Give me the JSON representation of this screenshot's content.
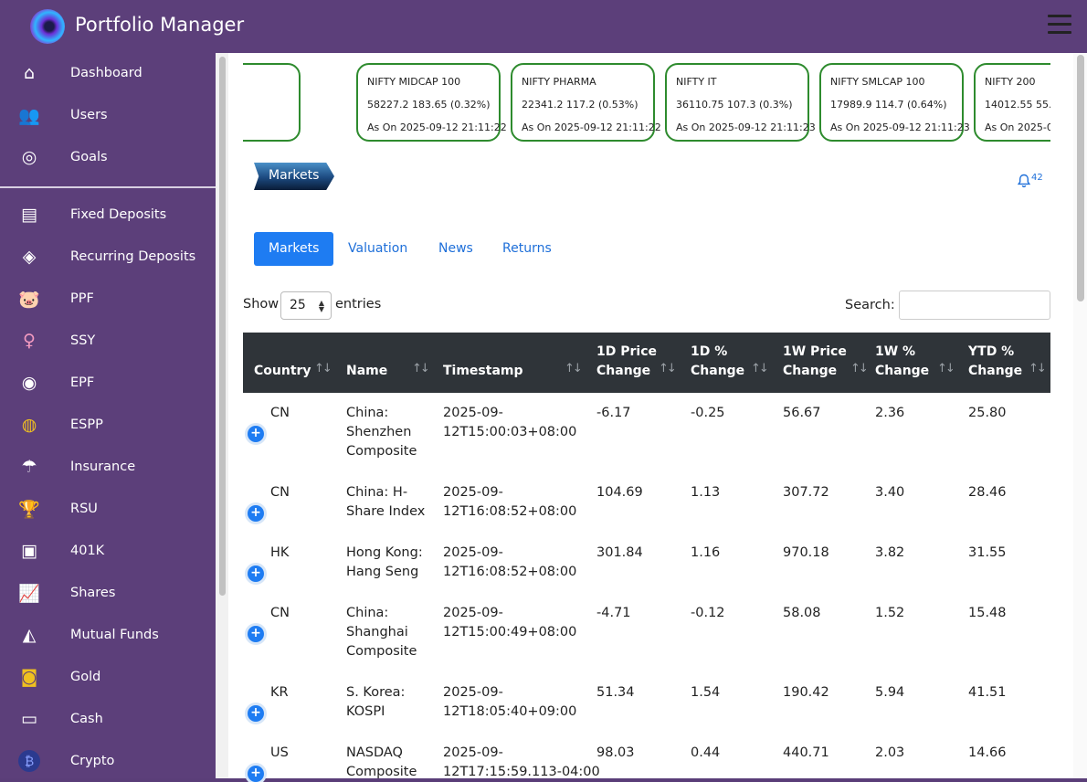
{
  "app": {
    "title": "Portfolio Manager"
  },
  "sidebar": {
    "items": [
      {
        "label": "Dashboard",
        "icon": "home-icon"
      },
      {
        "label": "Users",
        "icon": "users-icon"
      },
      {
        "label": "Goals",
        "icon": "target-icon"
      },
      {
        "label": "Fixed Deposits",
        "icon": "credit-card-icon"
      },
      {
        "label": "Recurring Deposits",
        "icon": "layers-icon"
      },
      {
        "label": "PPF",
        "icon": "piggy-bank-icon"
      },
      {
        "label": "SSY",
        "icon": "girl-icon"
      },
      {
        "label": "EPF",
        "icon": "epf-logo-icon"
      },
      {
        "label": "ESPP",
        "icon": "espp-icon"
      },
      {
        "label": "Insurance",
        "icon": "umbrella-icon"
      },
      {
        "label": "RSU",
        "icon": "trophy-icon"
      },
      {
        "label": "401K",
        "icon": "401k-icon"
      },
      {
        "label": "Shares",
        "icon": "chart-line-icon"
      },
      {
        "label": "Mutual Funds",
        "icon": "mutual-funds-icon"
      },
      {
        "label": "Gold",
        "icon": "gold-coins-icon"
      },
      {
        "label": "Cash",
        "icon": "cash-icon"
      },
      {
        "label": "Crypto",
        "icon": "bitcoin-icon"
      }
    ]
  },
  "ticker": [
    {
      "name": "",
      "value": "0.38%)",
      "date": "-12 21:11:22"
    },
    {
      "name": "NIFTY MIDCAP 100",
      "value": "58227.2  183.65 (0.32%)",
      "date": "As On 2025-09-12 21:11:22"
    },
    {
      "name": "NIFTY PHARMA",
      "value": "22341.2  117.2 (0.53%)",
      "date": "As On 2025-09-12 21:11:22"
    },
    {
      "name": "NIFTY IT",
      "value": "36110.75  107.3 (0.3%)",
      "date": "As On 2025-09-12 21:11:23"
    },
    {
      "name": "NIFTY SMLCAP 100",
      "value": "17989.9  114.7 (0.64%)",
      "date": "As On 2025-09-12 21:11:23"
    },
    {
      "name": "NIFTY 200",
      "value": "14012.55  55.5",
      "date": "As On 2025-0"
    }
  ],
  "page": {
    "ribbon": "Markets",
    "notifications": "42"
  },
  "tabs": [
    {
      "label": "Markets",
      "active": true
    },
    {
      "label": "Valuation",
      "active": false
    },
    {
      "label": "News",
      "active": false
    },
    {
      "label": "Returns",
      "active": false
    }
  ],
  "controls": {
    "show": "Show",
    "entries_value": "25",
    "entries": "entries",
    "search": "Search:",
    "search_value": ""
  },
  "table": {
    "headers": [
      [
        "Country"
      ],
      [
        "Name"
      ],
      [
        "Timestamp"
      ],
      [
        "1D Price",
        "Change"
      ],
      [
        "1D %",
        "Change"
      ],
      [
        "1W Price",
        "Change"
      ],
      [
        "1W %",
        "Change"
      ],
      [
        "YTD %",
        "Change"
      ]
    ],
    "rows": [
      {
        "country": "CN",
        "name": [
          "China:",
          "Shenzhen",
          "Composite"
        ],
        "ts": [
          "2025-09-",
          "12T15:00:03+08:00"
        ],
        "d1p": "-6.17",
        "d1pct": "-0.25",
        "w1p": "56.67",
        "w1pct": "2.36",
        "ytd": "25.80"
      },
      {
        "country": "CN",
        "name": [
          "China: H-",
          "Share Index"
        ],
        "ts": [
          "2025-09-",
          "12T16:08:52+08:00"
        ],
        "d1p": "104.69",
        "d1pct": "1.13",
        "w1p": "307.72",
        "w1pct": "3.40",
        "ytd": "28.46"
      },
      {
        "country": "HK",
        "name": [
          "Hong Kong:",
          "Hang Seng"
        ],
        "ts": [
          "2025-09-",
          "12T16:08:52+08:00"
        ],
        "d1p": "301.84",
        "d1pct": "1.16",
        "w1p": "970.18",
        "w1pct": "3.82",
        "ytd": "31.55"
      },
      {
        "country": "CN",
        "name": [
          "China:",
          "Shanghai",
          "Composite"
        ],
        "ts": [
          "2025-09-",
          "12T15:00:49+08:00"
        ],
        "d1p": "-4.71",
        "d1pct": "-0.12",
        "w1p": "58.08",
        "w1pct": "1.52",
        "ytd": "15.48"
      },
      {
        "country": "KR",
        "name": [
          "S. Korea:",
          "KOSPI"
        ],
        "ts": [
          "2025-09-",
          "12T18:05:40+09:00"
        ],
        "d1p": "51.34",
        "d1pct": "1.54",
        "w1p": "190.42",
        "w1pct": "5.94",
        "ytd": "41.51"
      },
      {
        "country": "US",
        "name": [
          "NASDAQ",
          "Composite"
        ],
        "ts": [
          "2025-09-",
          "12T17:15:59.113-04:00"
        ],
        "d1p": "98.03",
        "d1pct": "0.44",
        "w1p": "440.71",
        "w1pct": "2.03",
        "ytd": "14.66"
      }
    ]
  }
}
